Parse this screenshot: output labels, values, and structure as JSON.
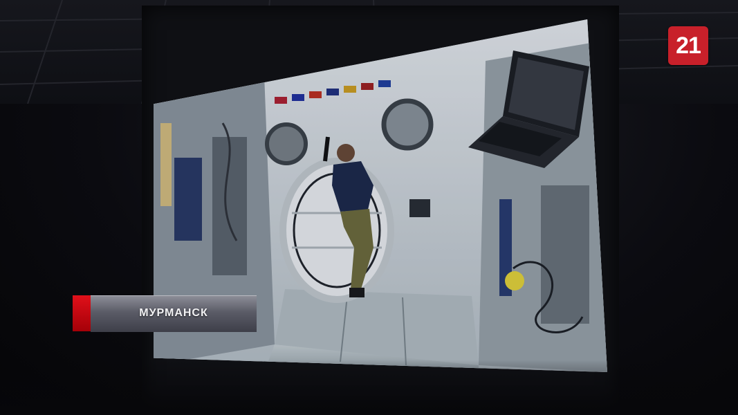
{
  "broadcast": {
    "channel_logo": "21",
    "location_caption": "МУРМАНСК"
  },
  "colors": {
    "logo_red": "#c8202a",
    "caption_accent": "#e0101a"
  }
}
